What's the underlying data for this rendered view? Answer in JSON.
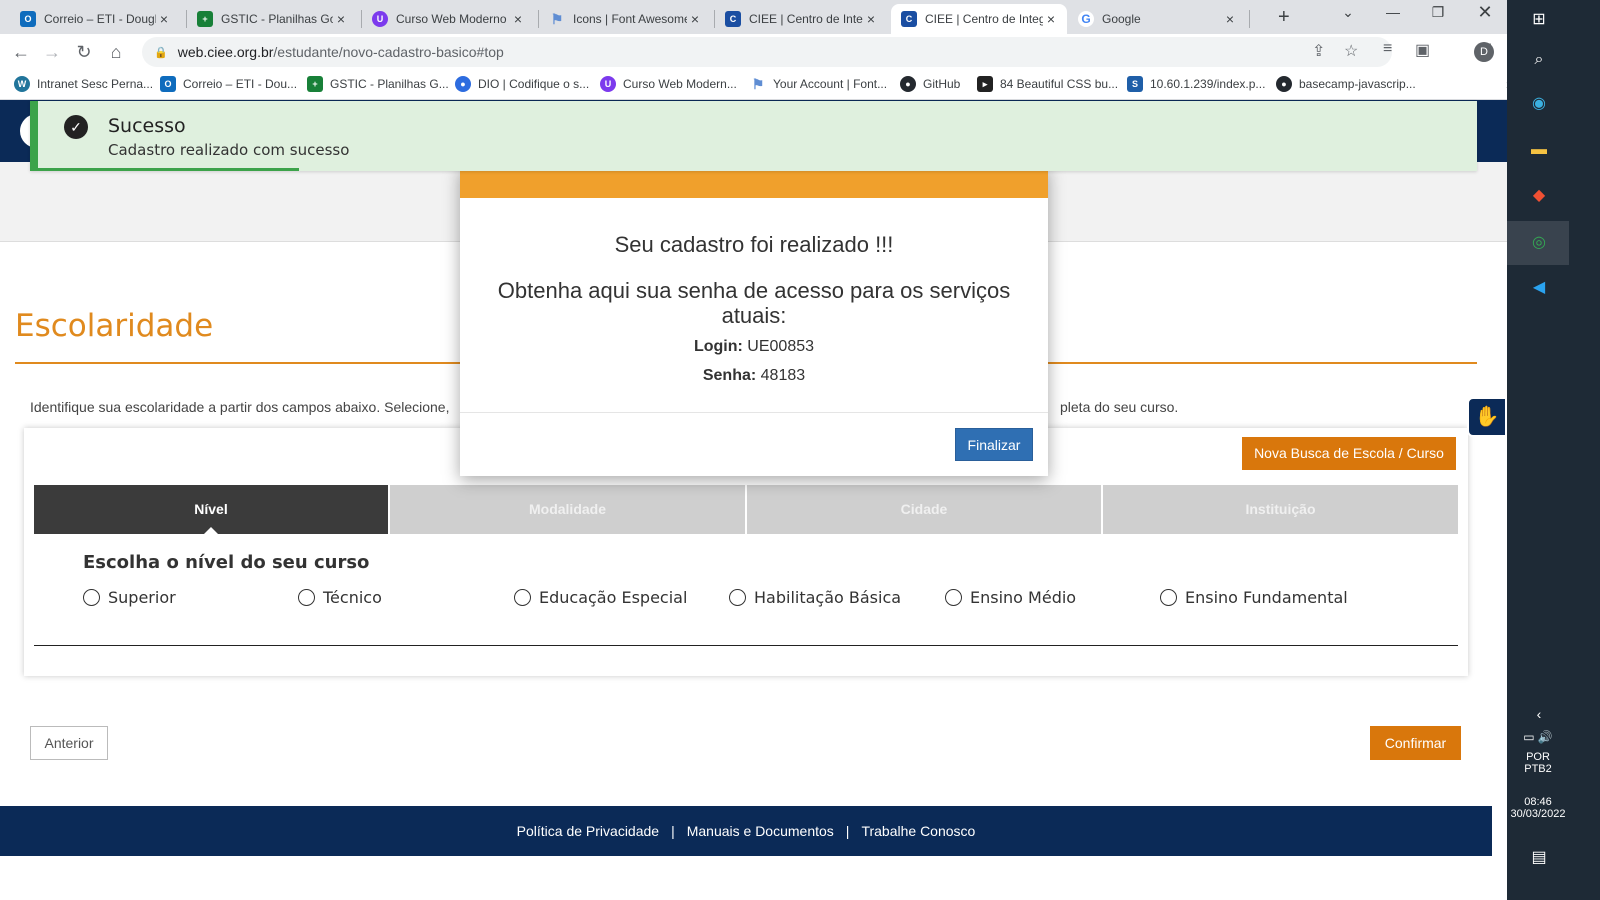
{
  "browser": {
    "tabs": [
      {
        "label": "Correio – ETI - Dougla",
        "color": "#0f6cbd",
        "glyph": "O"
      },
      {
        "label": "GSTIC - Planilhas Goo",
        "color": "#188038",
        "glyph": "+"
      },
      {
        "label": "Curso Web Moderno (",
        "color": "#7c3aed",
        "glyph": "U"
      },
      {
        "label": "Icons | Font Awesome",
        "color": "#5f8dd3",
        "glyph": "⚑"
      },
      {
        "label": "CIEE | Centro de Integ",
        "color": "#1a4ea2",
        "glyph": "C"
      },
      {
        "label": "CIEE | Centro de Integ",
        "color": "#1a4ea2",
        "glyph": "C"
      },
      {
        "label": "Google",
        "color": "#4285f4",
        "glyph": "G"
      }
    ],
    "url_host": "web.ciee.org.br",
    "url_path": "/estudante/novo-cadastro-basico#top",
    "profile_initial": "D",
    "bookmarks": [
      {
        "label": "Intranet Sesc Perna...",
        "color": "#21759b",
        "glyph": "W"
      },
      {
        "label": "Correio – ETI - Dou...",
        "color": "#0f6cbd",
        "glyph": "O"
      },
      {
        "label": "GSTIC - Planilhas G...",
        "color": "#188038",
        "glyph": "+"
      },
      {
        "label": "DIO | Codifique o s...",
        "color": "#2d6cdf",
        "glyph": "●"
      },
      {
        "label": "Curso Web Modern...",
        "color": "#7c3aed",
        "glyph": "U"
      },
      {
        "label": "Your Account | Font...",
        "color": "#5f8dd3",
        "glyph": "⚑"
      },
      {
        "label": "GitHub",
        "color": "#24292f",
        "glyph": "●"
      },
      {
        "label": "84 Beautiful CSS bu...",
        "color": "#222222",
        "glyph": "▸"
      },
      {
        "label": "10.60.1.239/index.p...",
        "color": "#1f5fa8",
        "glyph": "S"
      },
      {
        "label": "basecamp-javascrip...",
        "color": "#24292f",
        "glyph": "●"
      }
    ]
  },
  "toast": {
    "title": "Sucesso",
    "message": "Cadastro realizado com sucesso"
  },
  "modal": {
    "title": "Seu cadastro foi realizado !!!",
    "subtitle": "Obtenha aqui sua senha de acesso para os serviços atuais:",
    "login_label": "Login:",
    "login_value": "UE00853",
    "senha_label": "Senha:",
    "senha_value": "48183",
    "finalizar": "Finalizar"
  },
  "page": {
    "section_title": "Escolaridade",
    "intro": "Identifique sua escolaridade a partir dos campos abaixo. Selecione,",
    "intro_tail": "pleta do seu curso.",
    "nova_busca": "Nova Busca de Escola / Curso",
    "steps": [
      "Nível",
      "Modalidade",
      "Cidade",
      "Instituição"
    ],
    "question": "Escolha o nível do seu curso",
    "levels": [
      "Superior",
      "Técnico",
      "Educação Especial",
      "Habilitação Básica",
      "Ensino Médio",
      "Ensino Fundamental"
    ],
    "anterior": "Anterior",
    "confirmar": "Confirmar"
  },
  "footer": {
    "links": [
      "Política de Privacidade",
      "Manuais e Documentos",
      "Trabalhe Conosco"
    ],
    "separator": "|"
  },
  "system": {
    "lang1": "POR",
    "lang2": "PTB2",
    "time": "08:46",
    "date": "30/03/2022"
  }
}
